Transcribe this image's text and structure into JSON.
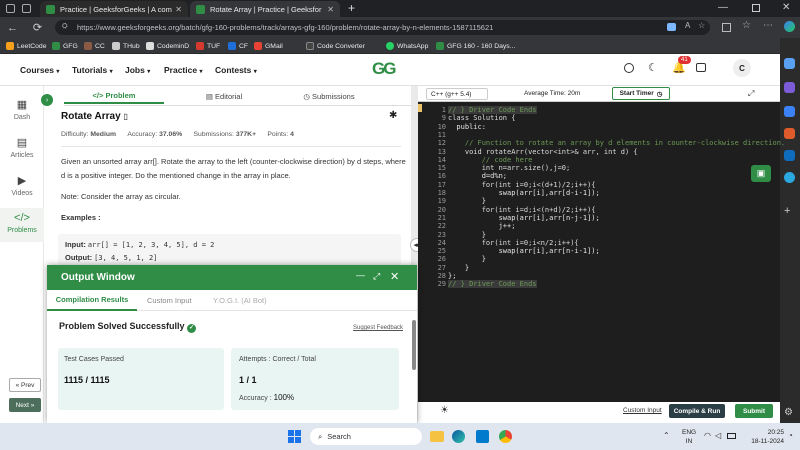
{
  "browser": {
    "tabs": [
      {
        "title": "Practice | GeeksforGeeks | A com"
      },
      {
        "title": "Rotate Array | Practice | Geeksfor"
      }
    ],
    "new_tab": "+",
    "url": "https://www.geeksforgeeks.org/batch/gfg-160-problems/track/arrays-gfg-160/problem/rotate-array-by-n-elements-1587115621",
    "bookmarks": [
      "LeetCode",
      "GFG",
      "CC",
      "THub",
      "CodeminD",
      "TUF",
      "CF",
      "GMail",
      "Code Converter",
      "WhatsApp",
      "GFG 160 - 160 Days..."
    ]
  },
  "gfg": {
    "logo": "GG",
    "menu": [
      "Courses",
      "Tutorials",
      "Jobs",
      "Practice",
      "Contests"
    ],
    "notification_count": "41",
    "avatar": "C"
  },
  "left_nav": [
    "Dash",
    "Articles",
    "Videos",
    "Problems"
  ],
  "nav_buttons": {
    "prev": "« Prev",
    "next": "Next »"
  },
  "problem_tabs": [
    "Problem",
    "Editorial",
    "Submissions"
  ],
  "problem": {
    "title": "Rotate Array",
    "difficulty_label": "Difficulty:",
    "difficulty": "Medium",
    "accuracy_label": "Accuracy:",
    "accuracy": "37.06%",
    "submissions_label": "Submissions:",
    "submissions": "377K+",
    "points_label": "Points:",
    "points": "4",
    "desc1": "Given an unsorted array arr[]. Rotate the array to the left (counter-clockwise direction) by d steps, where d is a positive integer. Do the mentioned change in the array in place.",
    "desc2": "Note: Consider the array as circular.",
    "examples_heading": "Examples :",
    "input_label": "Input:",
    "input_value": "arr[] = [1, 2, 3, 4, 5], d = 2",
    "output_label": "Output:",
    "output_value": "[3, 4, 5, 1, 2]"
  },
  "editor": {
    "language": "C++ (g++ 5.4)",
    "avg_time": "Average Time: 20m",
    "start_timer": "Start Timer",
    "lines": [
      {
        "n": "1",
        "code": "// } Driver Code Ends"
      },
      {
        "n": "9",
        "code": "class Solution {"
      },
      {
        "n": "10",
        "code": "  public:"
      },
      {
        "n": "11",
        "code": ""
      },
      {
        "n": "12",
        "code": "    // Function to rotate an array by d elements in counter-clockwise direction."
      },
      {
        "n": "13",
        "code": "    void rotateArr(vector<int>& arr, int d) {"
      },
      {
        "n": "14",
        "code": "        // code here"
      },
      {
        "n": "15",
        "code": "        int n=arr.size(),j=0;"
      },
      {
        "n": "16",
        "code": "        d=d%n;"
      },
      {
        "n": "17",
        "code": "        for(int i=0;i<(d+1)/2;i++){"
      },
      {
        "n": "18",
        "code": "            swap(arr[i],arr[d-i-1]);"
      },
      {
        "n": "19",
        "code": "        }"
      },
      {
        "n": "20",
        "code": "        for(int i=d;i<(n+d)/2;i++){"
      },
      {
        "n": "21",
        "code": "            swap(arr[i],arr[n-j-1]);"
      },
      {
        "n": "22",
        "code": "            j++;"
      },
      {
        "n": "23",
        "code": "        }"
      },
      {
        "n": "24",
        "code": "        for(int i=0;i<n/2;i++){"
      },
      {
        "n": "25",
        "code": "            swap(arr[i],arr[n-i-1]);"
      },
      {
        "n": "26",
        "code": "        }"
      },
      {
        "n": "27",
        "code": "    }"
      },
      {
        "n": "28",
        "code": "};"
      },
      {
        "n": "29",
        "code": "// } Driver Code Ends"
      }
    ],
    "custom_input": "Custom Input",
    "compile_run": "Compile & Run",
    "submit": "Submit"
  },
  "output_window": {
    "title": "Output Window",
    "tabs": [
      "Compilation Results",
      "Custom Input",
      "Y.O.G.I. (AI Bot)"
    ],
    "status": "Problem Solved Successfully",
    "suggest": "Suggest Feedback",
    "tests_label": "Test Cases Passed",
    "tests_value": "1115 / 1115",
    "attempts_label": "Attempts : Correct / Total",
    "attempts_value": "1 / 1",
    "accuracy_label": "Accuracy :",
    "accuracy_value": "100%"
  },
  "taskbar": {
    "search": "Search",
    "lang_line1": "ENG",
    "lang_line2": "IN",
    "time": "20:25",
    "date": "18-11-2024"
  },
  "colors": {
    "gfg_green": "#2f8d46",
    "code_bg": "#1e1e1e",
    "comment": "#6a9955",
    "keyword": "#569cd6",
    "number": "#b5cea8"
  }
}
